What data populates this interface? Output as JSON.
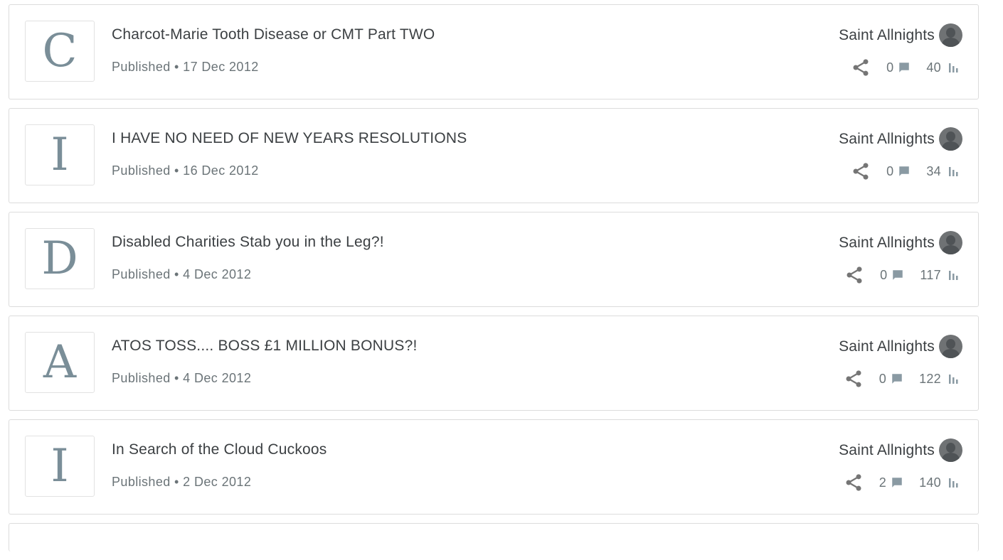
{
  "posts": [
    {
      "initial": "C",
      "title": "Charcot-Marie Tooth Disease or CMT Part TWO",
      "meta": "Published • 17 Dec 2012",
      "author": "Saint Allnights",
      "comments": "0",
      "views": "40"
    },
    {
      "initial": "I",
      "title": "I HAVE NO NEED OF NEW YEARS RESOLUTIONS",
      "meta": "Published • 16 Dec 2012",
      "author": "Saint Allnights",
      "comments": "0",
      "views": "34"
    },
    {
      "initial": "D",
      "title": "Disabled Charities Stab you in the Leg?!",
      "meta": "Published • 4 Dec 2012",
      "author": "Saint Allnights",
      "comments": "0",
      "views": "117"
    },
    {
      "initial": "A",
      "title": "ATOS TOSS.... BOSS £1 MILLION BONUS?!",
      "meta": "Published • 4 Dec 2012",
      "author": "Saint Allnights",
      "comments": "0",
      "views": "122"
    },
    {
      "initial": "I",
      "title": "In Search of the Cloud Cuckoos",
      "meta": "Published • 2 Dec 2012",
      "author": "Saint Allnights",
      "comments": "2",
      "views": "140"
    }
  ],
  "icons": {
    "share": "share-icon",
    "comment": "comment-icon",
    "views": "bar-chart-icon",
    "avatar": "avatar-placeholder"
  },
  "colors": {
    "thumb_letter": "#7a8e98",
    "icon_grey": "#8a9aa3",
    "share_grey": "#757575",
    "border": "#dcdcdc"
  }
}
